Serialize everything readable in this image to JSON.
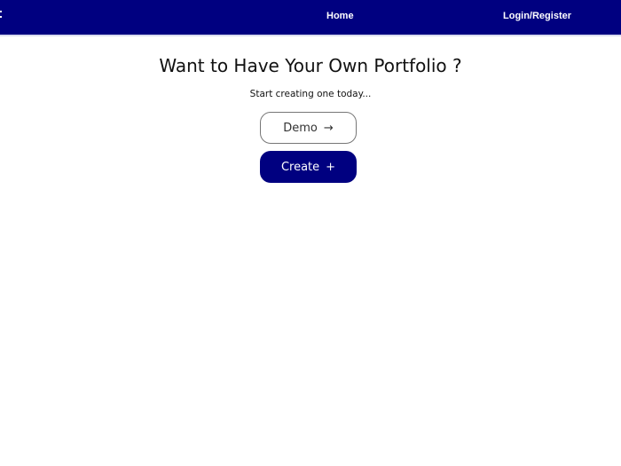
{
  "navbar": {
    "menu_icon": "menu-icon",
    "links": [
      {
        "label": "Home"
      },
      {
        "label": "Login/Register"
      }
    ],
    "background_color": "#000080"
  },
  "hero": {
    "title": "Want to Have Your Own Portfolio ?",
    "subtitle": "Start creating one today...",
    "demo_button": {
      "label": "Demo",
      "icon": "→"
    },
    "create_button": {
      "label": "Create",
      "icon": "+",
      "color": "#000080"
    }
  }
}
